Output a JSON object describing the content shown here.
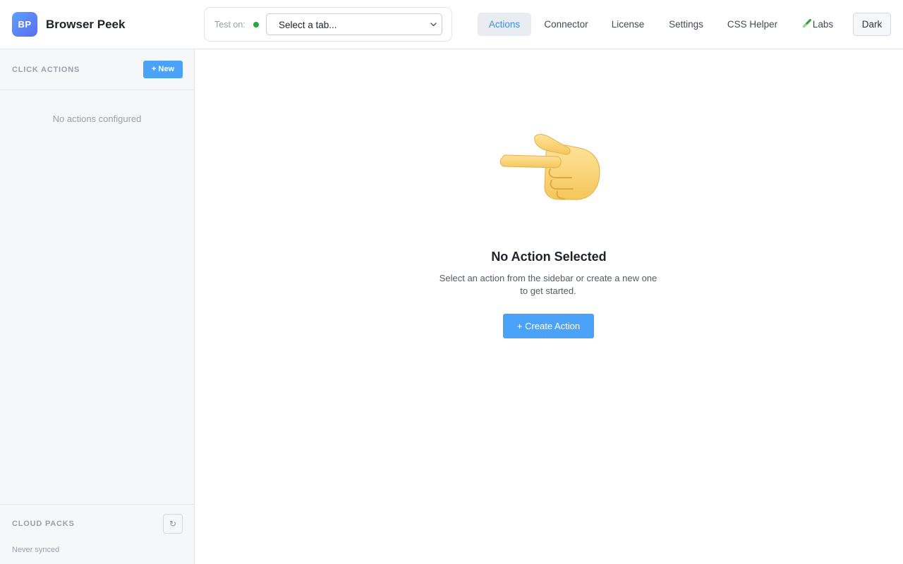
{
  "app": {
    "logo_text": "BP",
    "title": "Browser Peek"
  },
  "test_on": {
    "label": "Test on:",
    "status_color": "#28a745",
    "select_value": "Select a tab..."
  },
  "nav": {
    "items": [
      {
        "label": "Actions",
        "active": true
      },
      {
        "label": "Connector",
        "active": false
      },
      {
        "label": "License",
        "active": false
      },
      {
        "label": "Settings",
        "active": false
      },
      {
        "label": "CSS Helper",
        "active": false
      },
      {
        "label": "Labs",
        "icon": "test-tube-icon",
        "active": false
      }
    ],
    "theme_toggle_label": "Dark"
  },
  "sidebar": {
    "actions_title": "CLICK ACTIONS",
    "new_button_label": "+ New",
    "empty_text": "No actions configured",
    "cloud_title": "CLOUD PACKS",
    "refresh_icon": "refresh-icon",
    "sync_status": "Never synced"
  },
  "main": {
    "hero_icon": "pointing-left-hand-icon",
    "empty_title": "No Action Selected",
    "empty_description": "Select an action from the sidebar or create a new one to get started.",
    "create_button_label": "+ Create Action"
  },
  "colors": {
    "accent": "#4aa3f8",
    "active_nav_text": "#3d8ef0",
    "active_nav_bg": "#e9edf2"
  }
}
